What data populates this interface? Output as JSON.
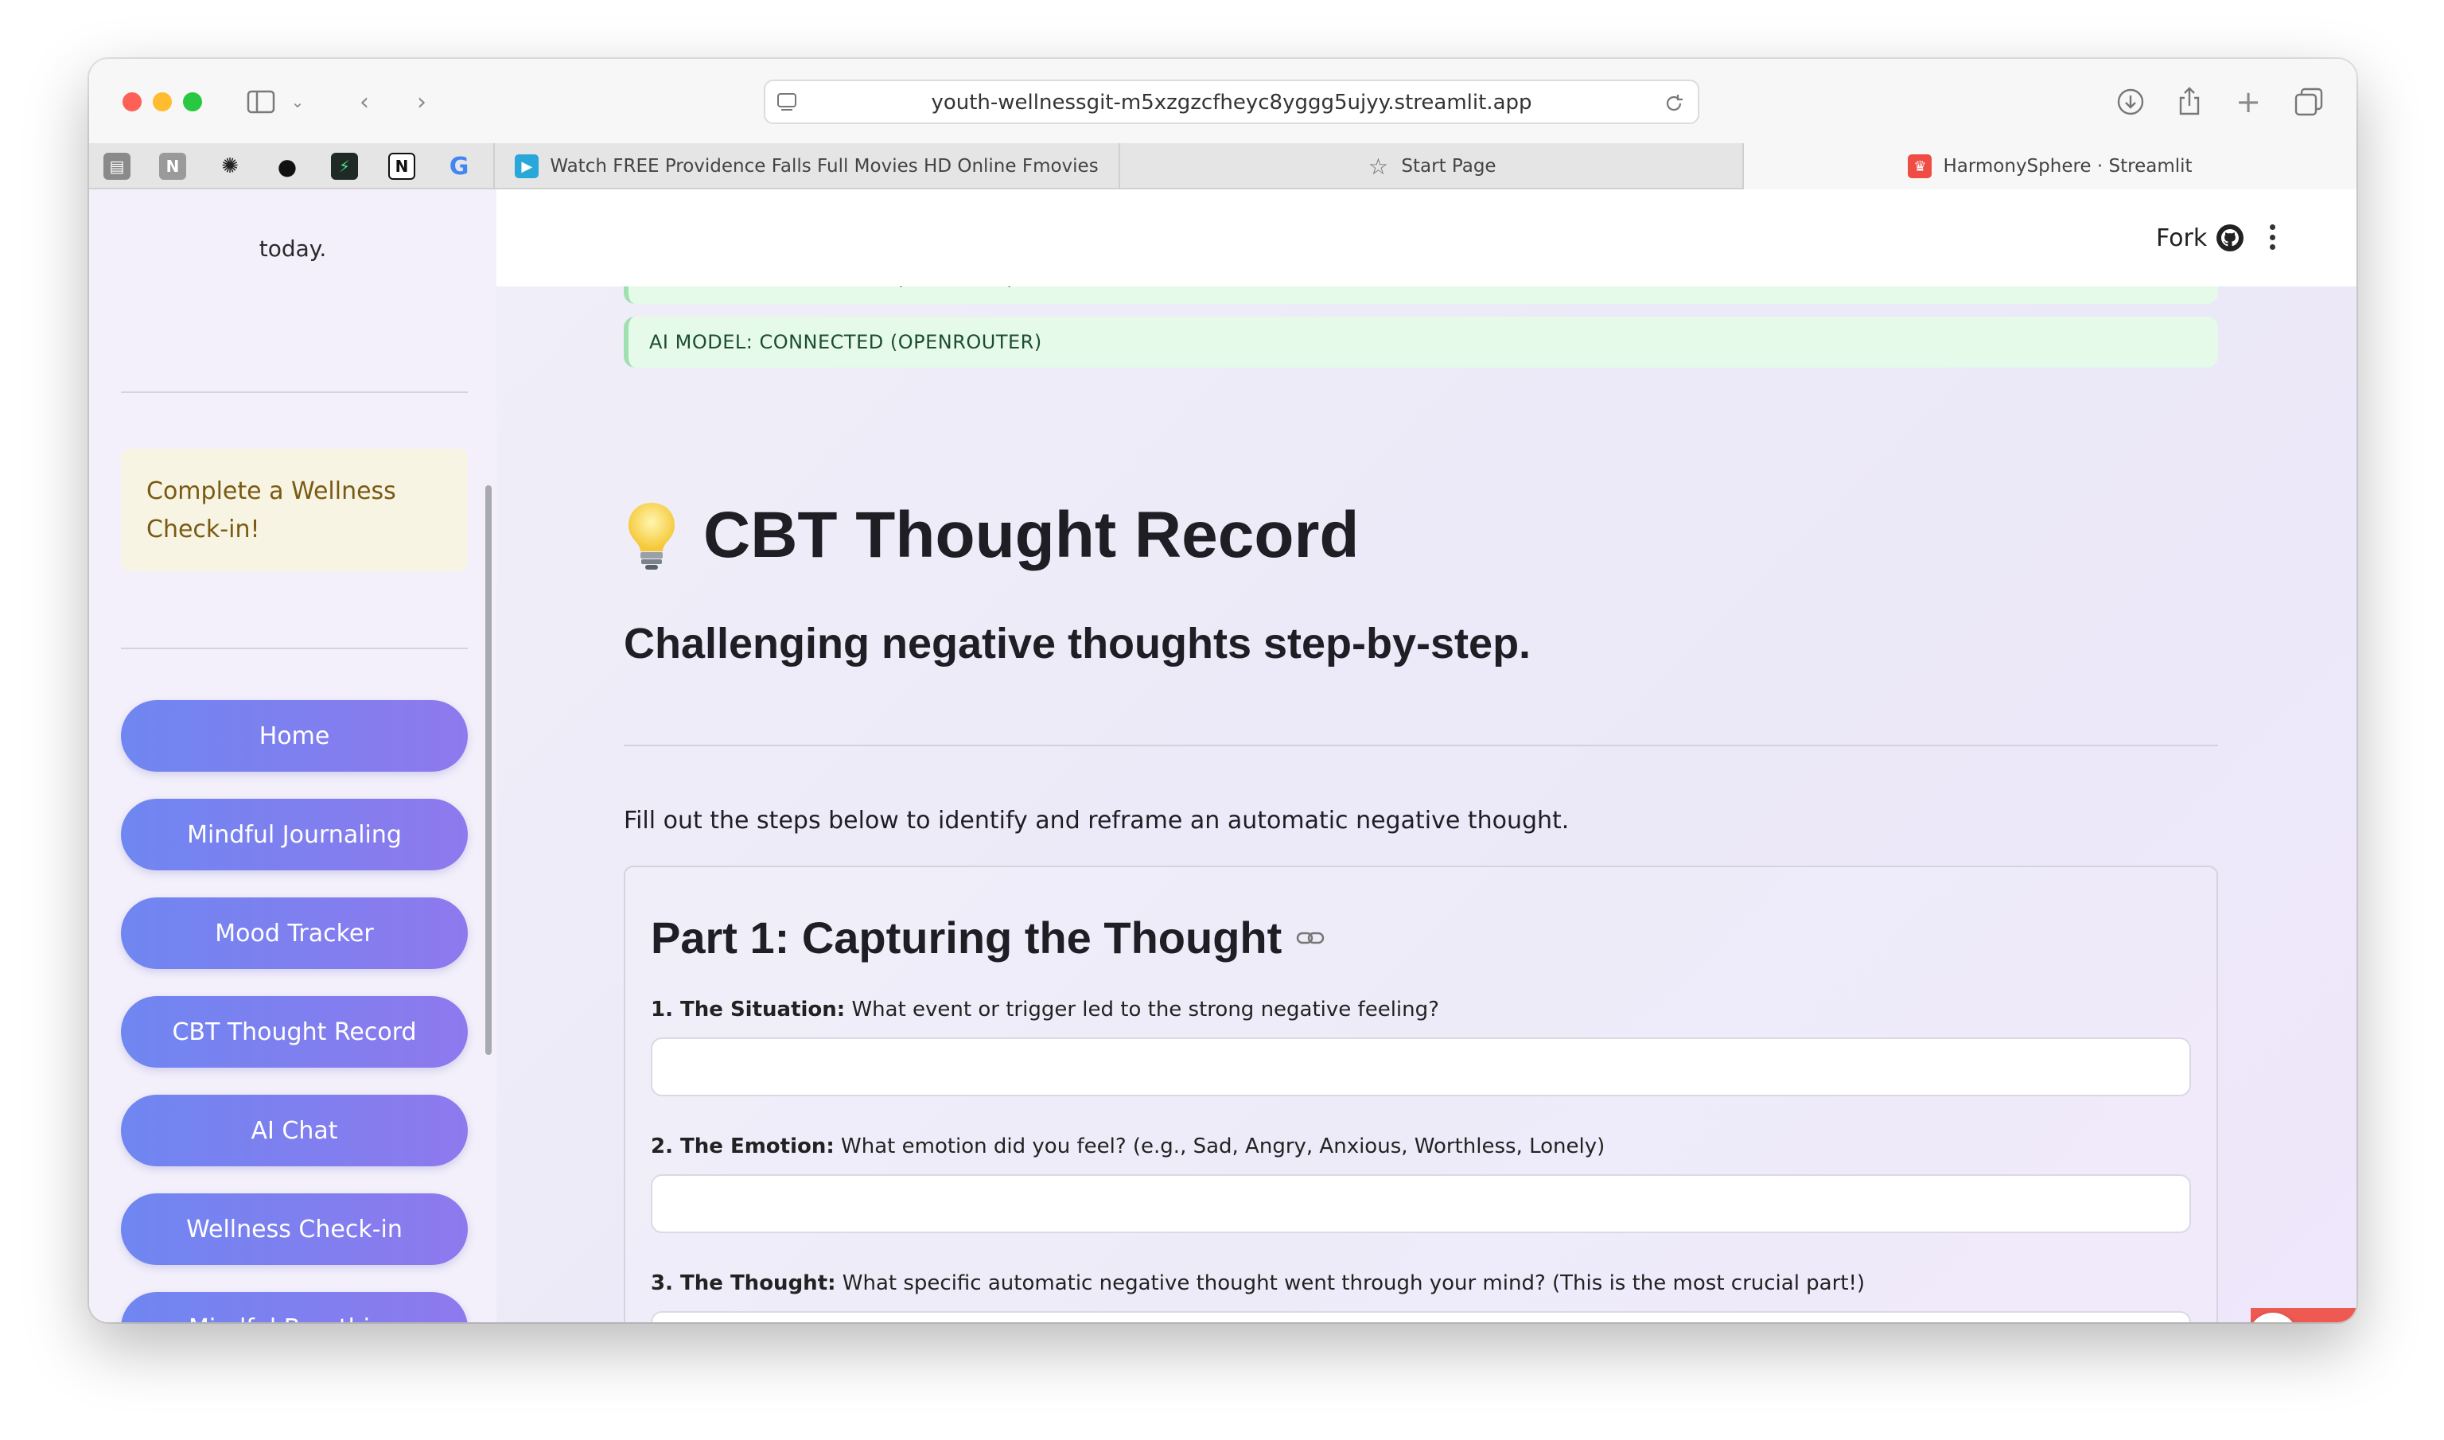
{
  "browser": {
    "url": "youth-wellnessgit-m5xzgzcfheyc8yggg5ujyy.streamlit.app",
    "tabs": [
      {
        "label": "Watch FREE Providence Falls Full Movies HD Online Fmovies"
      },
      {
        "label": "Start Page"
      },
      {
        "label": "HarmonySphere · Streamlit"
      }
    ]
  },
  "sidebar": {
    "top_text": "today.",
    "note": "Complete a Wellness Check-in!",
    "nav": [
      {
        "label": "Home"
      },
      {
        "label": "Mindful Journaling"
      },
      {
        "label": "Mood Tracker"
      },
      {
        "label": "CBT Thought Record"
      },
      {
        "label": "AI Chat"
      },
      {
        "label": "Wellness Check-in"
      },
      {
        "label": "Mindful Breathing"
      }
    ]
  },
  "header": {
    "fork_label": "Fork"
  },
  "status": {
    "database": "DATABASE: CONNECTED (SUPABASE)",
    "ai_model": "AI MODEL: CONNECTED (OPENROUTER)"
  },
  "main": {
    "title": "CBT Thought Record",
    "subtitle": "Challenging negative thoughts step-by-step.",
    "intro": "Fill out the steps below to identify and reframe an automatic negative thought.",
    "part1": {
      "title": "Part 1: Capturing the Thought",
      "questions": [
        {
          "bold": "1. The Situation:",
          "text": " What event or trigger led to the strong negative feeling?",
          "value": ""
        },
        {
          "bold": "2. The Emotion:",
          "text": " What emotion did you feel? (e.g., Sad, Angry, Anxious, Worthless, Lonely)",
          "value": ""
        },
        {
          "bold": "3. The Thought:",
          "text": " What specific automatic negative thought went through your mind? (This is the most crucial part!)",
          "value": ""
        }
      ]
    }
  },
  "colors": {
    "nav_gradient_start": "#6f86f0",
    "nav_gradient_end": "#8e79ee",
    "status_bg": "#e6faea",
    "note_bg": "#f7f4e4",
    "streamlit_red": "#ee5a52"
  }
}
